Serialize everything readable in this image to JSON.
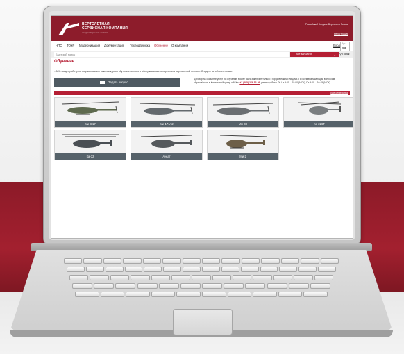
{
  "site": {
    "logo": {
      "line1": "ВЕРТОЛЕТНАЯ",
      "line2": "СЕРВИСНАЯ КОМПАНИЯ",
      "subline": "холдинг вертолеты россии"
    },
    "header_link": "Российский Холдинг Вертолеты России",
    "register": "Регистрация",
    "nav": [
      "НПО",
      "ТОиР",
      "Модернизация",
      "Документация",
      "Техподдержка",
      "Обучение",
      "О компании"
    ],
    "active_nav": "Обучение",
    "login": "Вход",
    "lang": {
      "option_a": "Рус",
      "option_b": "Eng"
    },
    "search": {
      "placeholder": "Быстрый поиск",
      "parts": "Все запчасти",
      "button": "Поиск"
    },
    "page_title": "Обучение",
    "intro": "«ВСК» ведет работу по формированию пакетов курсов обучения летного и обслуживающего персонала вертолетной техники. Следите за обновлениями.",
    "ask_button": "Задать вопрос",
    "notice": {
      "text1": "Договор на оказание услуг по обучению может быть заключен только с юридическими лицами. По всем возникающим вопросам обращайтесь в Контактный центр «ВСК»: ",
      "phone": "+7 (495) 276-53-56",
      "text2": ", режим работы Пн-Чт 9:00 – 18:00 (МСК), Пт 9:00 – 16:45 (МСК)."
    },
    "section_link": "Все семейства",
    "helicopters": [
      "Ми-8/17",
      "Ми-171А2",
      "Ми-38",
      "Ка-226Т",
      "Ка-32",
      "Ансат",
      "Ми-2"
    ],
    "colors": {
      "brand": "#8d1c2b",
      "accent": "#b51f34",
      "caption": "#56626a"
    }
  }
}
